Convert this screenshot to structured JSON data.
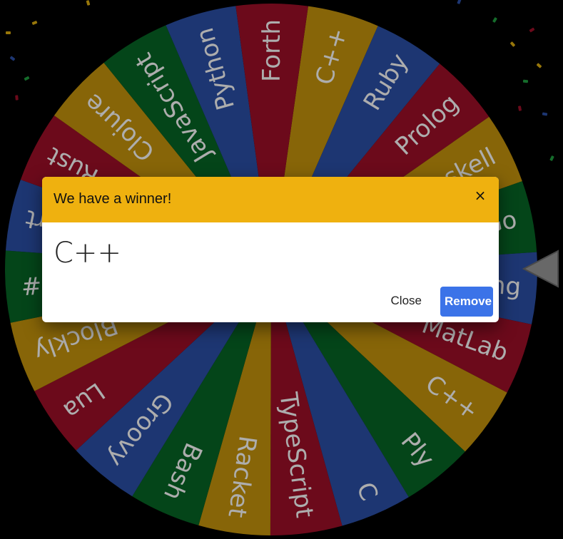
{
  "wheel": {
    "colors": {
      "blue": "#2c50a8",
      "red": "#a01028",
      "yellow": "#c8960c",
      "green": "#076625"
    },
    "segments": [
      {
        "label": "C++",
        "color": "yellow"
      },
      {
        "label": "Ruby",
        "color": "blue"
      },
      {
        "label": "Prolog",
        "color": "red"
      },
      {
        "label": "Haskell",
        "color": "yellow"
      },
      {
        "label": "Go",
        "color": "green"
      },
      {
        "label": "Processing",
        "color": "blue"
      },
      {
        "label": "MatLab",
        "color": "red"
      },
      {
        "label": "C++",
        "color": "yellow"
      },
      {
        "label": "Ply",
        "color": "green"
      },
      {
        "label": "C",
        "color": "blue"
      },
      {
        "label": "TypeScript",
        "color": "red"
      },
      {
        "label": "Racket",
        "color": "yellow"
      },
      {
        "label": "Bash",
        "color": "green"
      },
      {
        "label": "Groovy",
        "color": "blue"
      },
      {
        "label": "Lua",
        "color": "red"
      },
      {
        "label": "Blockly",
        "color": "yellow"
      },
      {
        "label": "C#",
        "color": "green"
      },
      {
        "label": "Dart",
        "color": "blue"
      },
      {
        "label": "Rust",
        "color": "red"
      },
      {
        "label": "Clojure",
        "color": "yellow"
      },
      {
        "label": "JavaScript",
        "color": "green"
      },
      {
        "label": "Python",
        "color": "blue"
      },
      {
        "label": "Forth",
        "color": "red"
      }
    ]
  },
  "confetti_colors": [
    "#e0b010",
    "#2c50a8",
    "#a01028",
    "#20a040"
  ],
  "dialog": {
    "title": "We have a winner!",
    "close_icon": "×",
    "winner": "C++",
    "close_label": "Close",
    "remove_label": "Remove"
  }
}
